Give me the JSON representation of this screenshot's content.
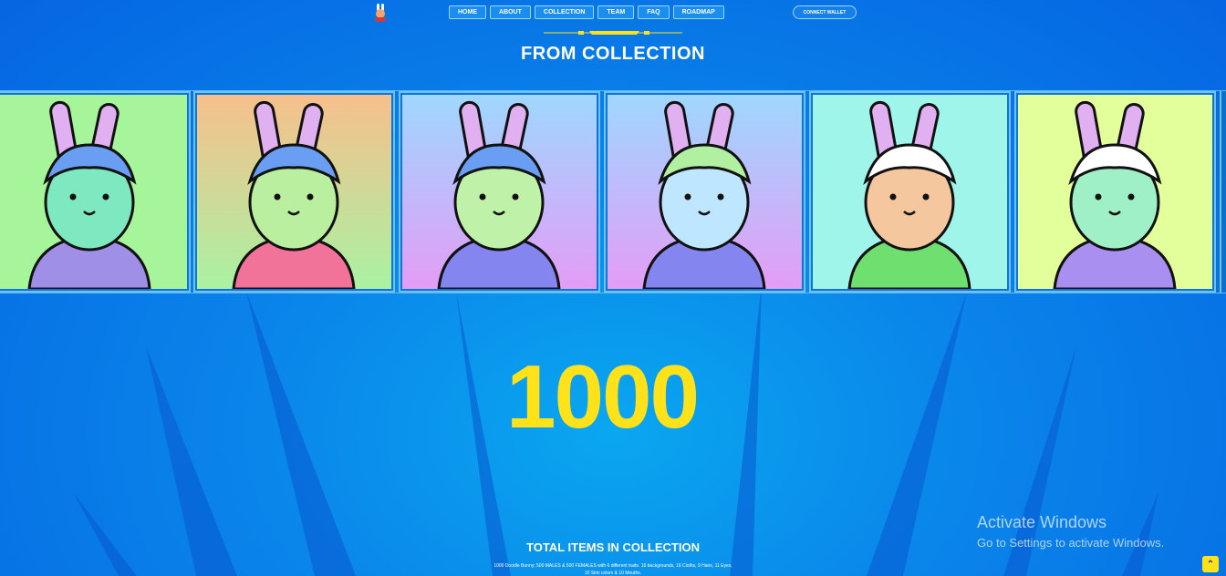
{
  "nav": {
    "items": [
      {
        "label": "HOME"
      },
      {
        "label": "ABOUT"
      },
      {
        "label": "COLLECTION"
      },
      {
        "label": "TEAM"
      },
      {
        "label": "FAQ"
      },
      {
        "label": "ROADMAP"
      }
    ],
    "connect_label": "CONNECT WALLET"
  },
  "section": {
    "title": "FROM COLLECTION"
  },
  "gallery": [
    {
      "bg_top": "#a6f59a",
      "bg_bottom": "#a6f59a",
      "skin": "#7ee8c0",
      "hair": "#6a9ef2",
      "shirt": "#9f8fe6"
    },
    {
      "bg_top": "#f7bf8c",
      "bg_bottom": "#a9f2a2",
      "skin": "#b9ef9e",
      "hair": "#6a9ef2",
      "shirt": "#f27399"
    },
    {
      "bg_top": "#9fd7ff",
      "bg_bottom": "#e39df5",
      "skin": "#bff2a8",
      "hair": "#6a9ef2",
      "shirt": "#8585f0"
    },
    {
      "bg_top": "#9fd7ff",
      "bg_bottom": "#e39df5",
      "skin": "#bfe6ff",
      "hair": "#b0f0a0",
      "shirt": "#8585f0"
    },
    {
      "bg_top": "#a0f5ea",
      "bg_bottom": "#a0f5ea",
      "skin": "#f4c79e",
      "hair": "#ffffff",
      "shirt": "#6fe06f"
    },
    {
      "bg_top": "#e3ff9c",
      "bg_bottom": "#e3ff9c",
      "skin": "#9ff0c6",
      "hair": "#ffffff",
      "shirt": "#a88ff0"
    }
  ],
  "stats": {
    "count": "1000",
    "label": "TOTAL ITEMS IN COLLECTION",
    "description": "1000 Doodle Bunny; 500 MALES & 500 FEMALES with 6 different traits. 16 backgrounds, 16 Cloths, 9 Hairs, 11 Eyes, 10 Skin colors & 10 Mouths."
  },
  "os_overlay": {
    "title": "Activate Windows",
    "subtitle": "Go to Settings to activate Windows."
  },
  "colors": {
    "accent_yellow": "#ffe21a",
    "page_blue": "#0a86ea"
  }
}
